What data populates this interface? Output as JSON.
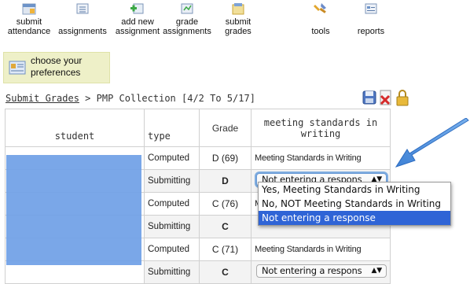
{
  "toolbar": {
    "items": [
      {
        "label_line1": "submit",
        "label_line2": "attendance",
        "icon": "calendar-icon"
      },
      {
        "label_line1": "",
        "label_line2": "assignments",
        "icon": "list-icon"
      },
      {
        "label_line1": "add new",
        "label_line2": "assignment",
        "icon": "add-assignment-icon"
      },
      {
        "label_line1": "grade",
        "label_line2": "assignments",
        "icon": "grade-icon"
      },
      {
        "label_line1": "submit",
        "label_line2": "grades",
        "icon": "submit-grades-icon"
      },
      {
        "label_line1": "",
        "label_line2": "tools",
        "icon": "tools-icon"
      },
      {
        "label_line1": "",
        "label_line2": "reports",
        "icon": "reports-icon"
      }
    ],
    "preferences": {
      "line1": "choose your",
      "line2": "preferences",
      "icon": "preferences-icon"
    }
  },
  "breadcrumb": {
    "link": "Submit Grades",
    "separator": ">",
    "current": "PMP Collection [4/2 To 5/17]"
  },
  "actions": {
    "icons": [
      "save-icon",
      "delete-icon",
      "lock-icon"
    ]
  },
  "table": {
    "headers": {
      "student": "student",
      "type": "type",
      "grade": "Grade",
      "meeting": "meeting standards in writing"
    },
    "rows": [
      {
        "type": "Computed",
        "grade": "D (69)",
        "meeting": "Meeting Standards in Writing",
        "kind": "computed"
      },
      {
        "type": "Submitting",
        "grade": "D",
        "meeting": "Not entering a respons",
        "kind": "submit"
      },
      {
        "type": "Computed",
        "grade": "C (76)",
        "meeting": "M",
        "kind": "computed"
      },
      {
        "type": "Submitting",
        "grade": "C",
        "meeting": "",
        "kind": "submit"
      },
      {
        "type": "Computed",
        "grade": "C (71)",
        "meeting": "Meeting Standards in Writing",
        "kind": "computed"
      },
      {
        "type": "Submitting",
        "grade": "C",
        "meeting": "Not entering a respons",
        "kind": "submit"
      }
    ]
  },
  "dropdown": {
    "options": [
      "Yes, Meeting Standards in Writing",
      "No, NOT Meeting Standards in Writing",
      "Not entering a response"
    ],
    "selected_index": 2
  },
  "colors": {
    "blur": "#6f9fe6",
    "arrow": "#4a8ad6",
    "selected": "#2f64d6",
    "preferences_bg": "#eef0c8"
  }
}
